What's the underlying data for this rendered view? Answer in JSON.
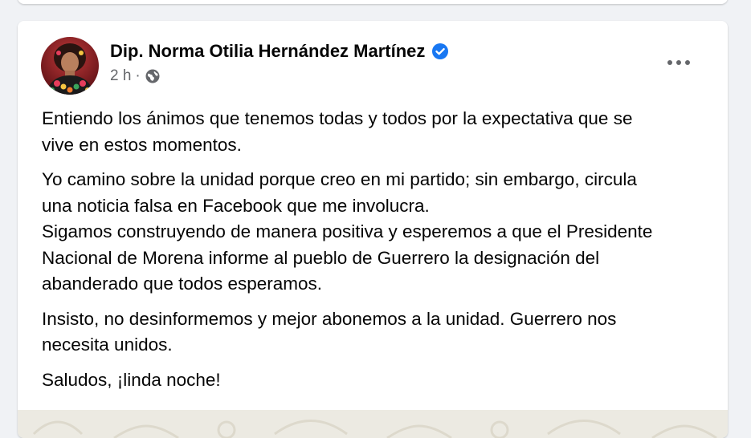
{
  "post": {
    "author": "Dip. Norma Otilia Hernández Martínez",
    "verified_icon": "verified-badge-icon",
    "time": "2 h",
    "separator": "·",
    "audience_icon": "globe-icon",
    "more_icon": "more-options-icon",
    "paragraphs": [
      {
        "lines": [
          "Entiendo los ánimos que tenemos todas y todos por la expectativa que se",
          "vive en estos momentos."
        ]
      },
      {
        "lines": [
          "Yo camino sobre la unidad porque creo en mi partido; sin embargo, circula",
          "una noticia falsa en Facebook que me involucra.",
          "Sigamos construyendo de manera positiva y esperemos a que el Presidente",
          "Nacional de Morena informe al pueblo de Guerrero la designación del",
          "abanderado que todos esperamos."
        ]
      },
      {
        "lines": [
          "Insisto, no desinformemos y mejor abonemos a la unidad. Guerrero nos",
          "necesita unidos."
        ]
      },
      {
        "lines": [
          "Saludos, ¡linda noche!"
        ]
      }
    ]
  },
  "colors": {
    "page_background": "#f0f2f5",
    "card_background": "#ffffff",
    "primary_text": "#050505",
    "secondary_text": "#65676b",
    "verified_blue": "#1877f2"
  }
}
